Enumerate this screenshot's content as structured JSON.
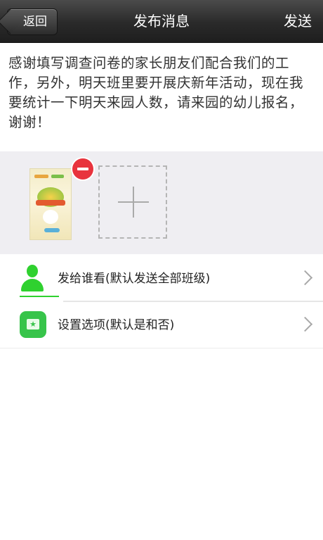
{
  "navbar": {
    "back_label": "返回",
    "title": "发布消息",
    "send_label": "发送"
  },
  "message": {
    "text": "感谢填写调查问卷的家长朋友们配合我们的工作，另外，明天班里要开展庆新年活动，现在我要统计一下明天来园人数，请来园的幼儿报名，谢谢！"
  },
  "photos": {
    "remove_icon": "minus-circle-icon",
    "add_icon": "plus-icon"
  },
  "options": {
    "recipients_label": "发给谁看(默认发送全部班级)",
    "settings_label": "设置选项(默认是和否)"
  },
  "colors": {
    "navbar": "#2a2a2a",
    "photo_area_bg": "#efeef2",
    "remove_badge": "#e8333d",
    "person_icon": "#2fd12f",
    "settings_icon": "#37c44a"
  }
}
